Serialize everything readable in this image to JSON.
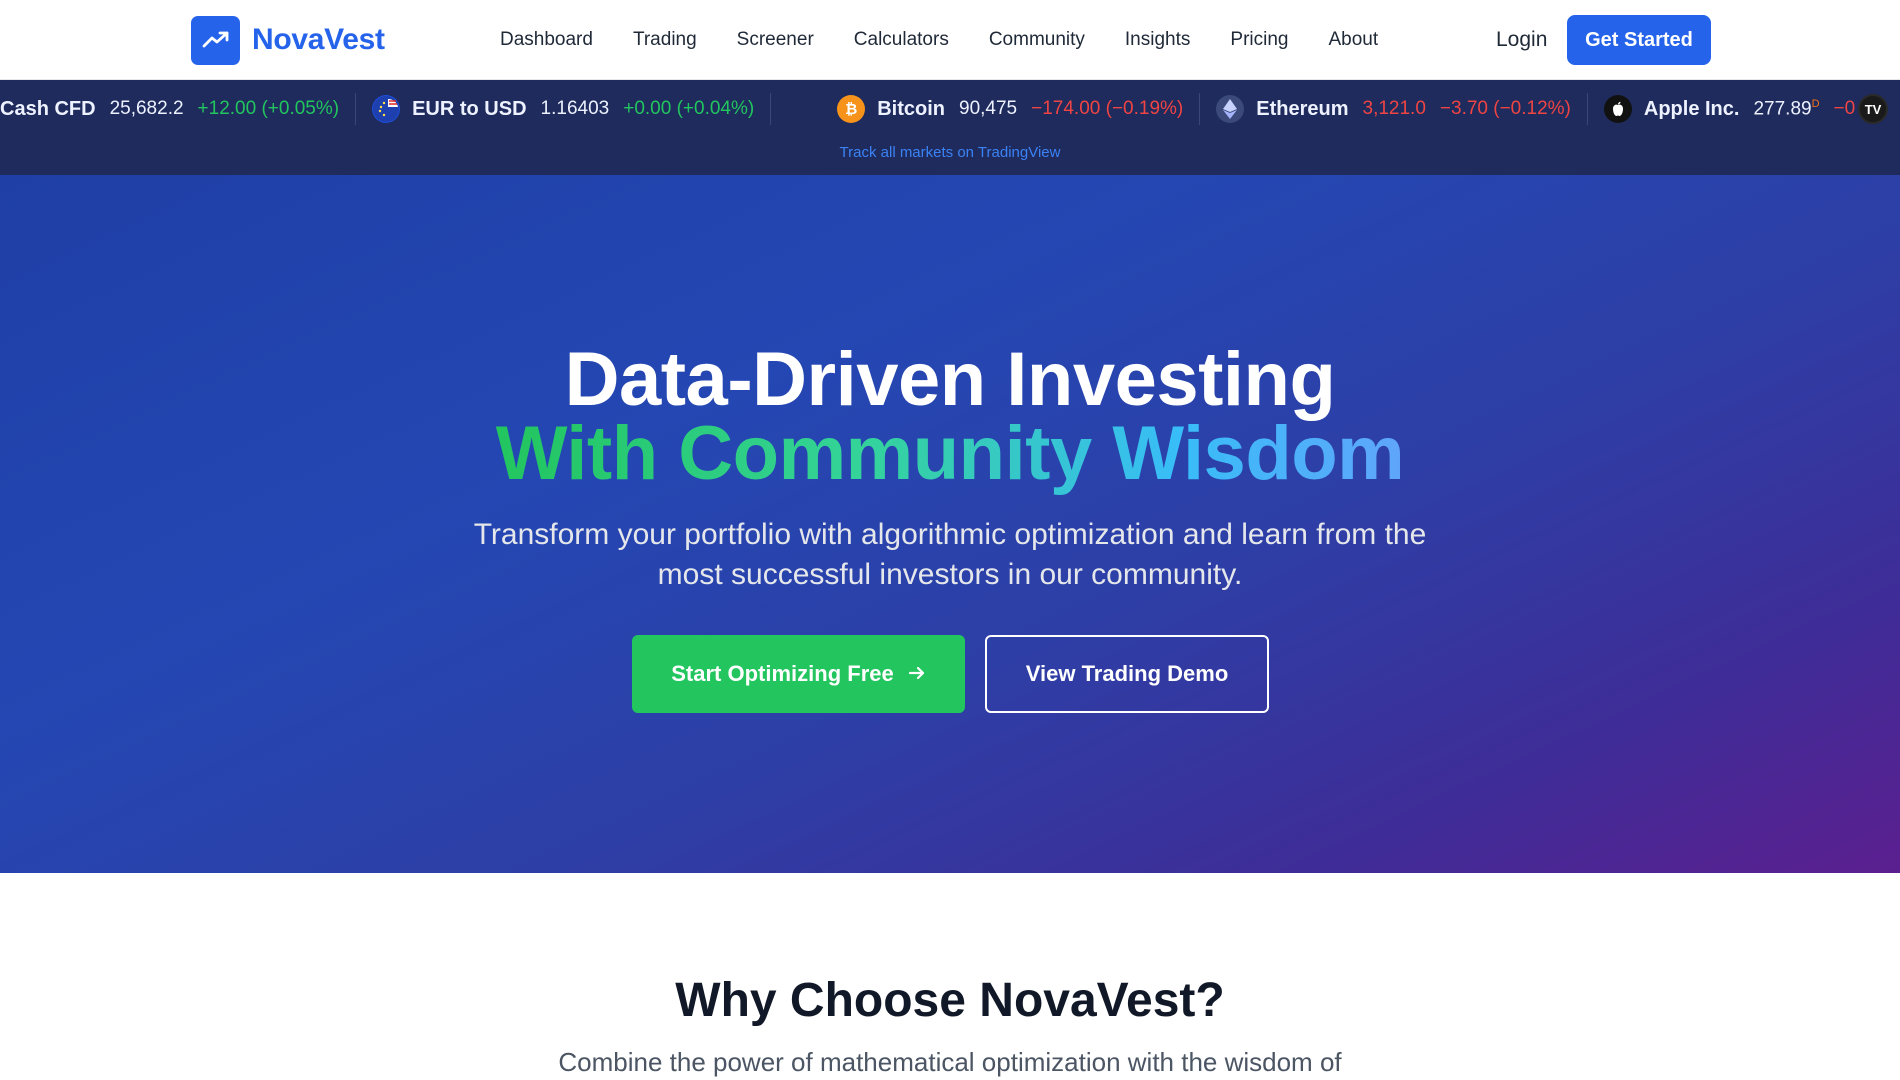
{
  "brand": {
    "name": "NovaVest",
    "logo_icon": "trending-up-icon",
    "accent": "#2563eb"
  },
  "nav": {
    "links": [
      "Dashboard",
      "Trading",
      "Screener",
      "Calculators",
      "Community",
      "Insights",
      "Pricing",
      "About"
    ],
    "login": "Login",
    "cta": "Get Started"
  },
  "ticker": {
    "items": [
      {
        "icon": "",
        "name": "Cash CFD",
        "price": "25,682.2",
        "change": "+12.00 (+0.05%)",
        "direction": "up"
      },
      {
        "icon": "eu-us-flag-icon",
        "name": "EUR to USD",
        "price": "1.16403",
        "change": "+0.00 (+0.04%)",
        "direction": "up"
      },
      {
        "icon": "bitcoin-icon",
        "name": "Bitcoin",
        "price": "90,475",
        "change": "−174.00 (−0.19%)",
        "direction": "down"
      },
      {
        "icon": "ethereum-icon",
        "name": "Ethereum",
        "price": "3,121.0",
        "change": "−3.70 (−0.12%)",
        "direction": "down"
      },
      {
        "icon": "apple-icon",
        "name": "Apple Inc.",
        "price": "277.89",
        "price_sup": "D",
        "change": "−0",
        "direction": "down"
      }
    ],
    "link_text": "Track all markets on TradingView",
    "badge": "TV",
    "colors": {
      "up": "#22c55e",
      "down": "#ef4444",
      "bg": "#1e2b5c"
    }
  },
  "hero": {
    "title_line1": "Data-Driven Investing",
    "title_line2": "With Community Wisdom",
    "subtitle": "Transform your portfolio with algorithmic optimization and learn from the most successful investors in our community.",
    "primary_button": "Start Optimizing Free",
    "secondary_button": "View Trading Demo",
    "colors": {
      "button_green": "#22c55e"
    }
  },
  "why": {
    "title": "Why Choose NovaVest?",
    "subtitle": "Combine the power of mathematical optimization with the wisdom of"
  }
}
